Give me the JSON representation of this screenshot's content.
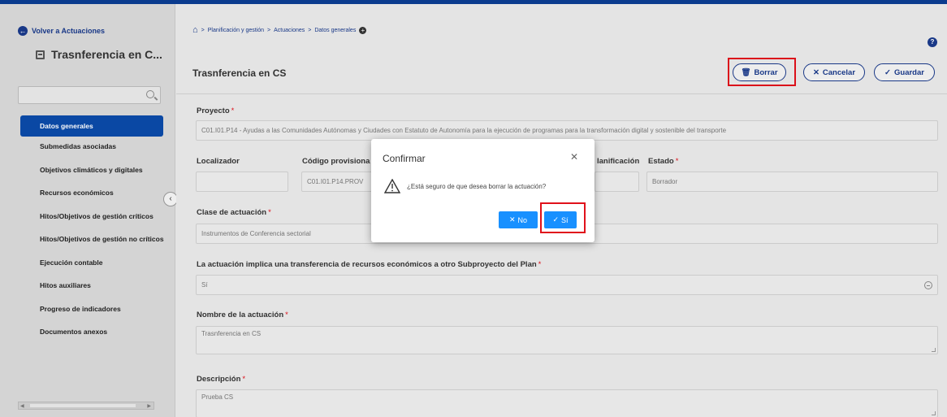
{
  "colors": {
    "brand": "#0b4aa8",
    "navy": "#1a3a8a",
    "highlight": "#e0111b",
    "primary": "#1890ff"
  },
  "sidebar": {
    "back_label": "Volver a Actuaciones",
    "title": "Trasnferencia en C...",
    "active_item": "Datos generales",
    "items": [
      "Submedidas asociadas",
      "Objetivos climáticos y digitales",
      "Recursos económicos",
      "Hitos/Objetivos de gestión críticos",
      "Hitos/Objetivos de gestión no críticos",
      "Ejecución contable",
      "Hitos auxiliares",
      "Progreso de indicadores",
      "Documentos anexos"
    ]
  },
  "breadcrumb": {
    "items": [
      "Planificación y gestión",
      "Actuaciones",
      "Datos generales"
    ]
  },
  "header": {
    "title": "Trasnferencia en CS",
    "borrar_label": "Borrar",
    "cancelar_label": "Cancelar",
    "guardar_label": "Guardar"
  },
  "form": {
    "proyecto_label": "Proyecto",
    "proyecto_value": "C01.I01.P14 - Ayudas a las Comunidades Autónomas y Ciudades con Estatuto de Autonomía para la ejecución de programas para la transformación digital y sostenible del transporte",
    "localizador_label": "Localizador",
    "codigo_label": "Código provisiona",
    "codigo_value": "C01.I01.P14.PROV",
    "planificacion_label": "lanificación",
    "estado_label": "Estado",
    "estado_value": "Borrador",
    "clase_label": "Clase de actuación",
    "clase_value": "Instrumentos de Conferencia sectorial",
    "transferencia_label": "La actuación implica una transferencia de recursos económicos a otro Subproyecto del Plan",
    "transferencia_value": "Sí",
    "nombre_label": "Nombre de la actuación",
    "nombre_value": "Trasnferencia en CS",
    "descripcion_label": "Descripción",
    "descripcion_value": "Prueba CS"
  },
  "dialog": {
    "title": "Confirmar",
    "message": "¿Está seguro de que desea borrar la actuación?",
    "no_label": "No",
    "si_label": "Sí"
  }
}
